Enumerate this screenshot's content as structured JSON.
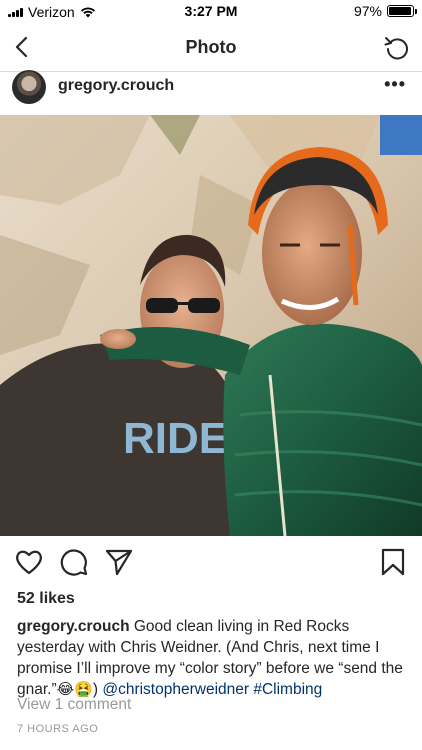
{
  "status": {
    "carrier": "Verizon",
    "time": "3:27 PM",
    "battery": "97%",
    "battery_level": 0.97
  },
  "nav": {
    "title": "Photo",
    "back_icon": "chevron-left-icon",
    "refresh_icon": "refresh-icon"
  },
  "post": {
    "username": "gregory.crouch",
    "more_label": "•••",
    "likes": "52 likes",
    "caption": {
      "user": "gregory.crouch",
      "text": "Good clean living in Red Rocks yesterday with Chris Weidner. (And Chris, next time I promise I’ll improve my “color story” before we “send the gnar.”",
      "emoji_1": "😂",
      "emoji_2": "🤮",
      "close": ")",
      "mention": "@christopherweidner",
      "hashtag": "#Climbing"
    },
    "view_comments": "View 1 comment",
    "time_ago": "7 HOURS AGO",
    "shirt_text": "RIDE"
  },
  "colors": {
    "link": "#003569",
    "muted": "#999999",
    "divider": "#dbdbdb"
  }
}
